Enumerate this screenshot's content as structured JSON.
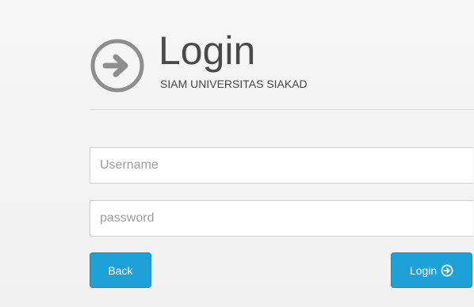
{
  "header": {
    "title": "Login",
    "subtitle": "SIAM UNIVERSITAS SIAKAD",
    "icon": "arrow-right-circle-icon"
  },
  "form": {
    "username_placeholder": "Username",
    "username_value": "",
    "password_placeholder": "password",
    "password_value": ""
  },
  "buttons": {
    "back_label": "Back",
    "login_label": "Login",
    "login_icon": "arrow-right-circle-icon"
  },
  "colors": {
    "accent": "#1ea1d6",
    "icon_gray": "#8e8e8e",
    "title_text": "#4a4a4a"
  }
}
